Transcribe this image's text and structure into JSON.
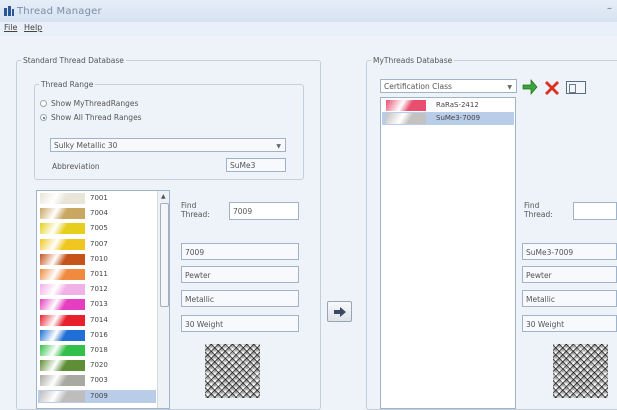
{
  "window": {
    "title": "Thread Manager",
    "minimize_glyph": "–"
  },
  "menu": {
    "items": [
      "File",
      "Help"
    ]
  },
  "standard_db": {
    "legend": "Standard Thread Database",
    "thread_range": {
      "legend": "Thread Range",
      "options": [
        "Show MyThreadRanges",
        "Show All Thread Ranges"
      ],
      "selected_index": 1
    },
    "range_select": {
      "value": "Sulky Metallic 30"
    },
    "abbreviation": {
      "label": "Abbreviation",
      "value": "SuMe3"
    },
    "threads": [
      {
        "code": "7001",
        "color": "#e9e5d9"
      },
      {
        "code": "7004",
        "color": "#c9a760"
      },
      {
        "code": "7005",
        "color": "#e6cf1c"
      },
      {
        "code": "7007",
        "color": "#f0c720"
      },
      {
        "code": "7010",
        "color": "#c6541a"
      },
      {
        "code": "7011",
        "color": "#f08a3e"
      },
      {
        "code": "7012",
        "color": "#f0b1e6"
      },
      {
        "code": "7013",
        "color": "#e63ec1"
      },
      {
        "code": "7014",
        "color": "#e8202e"
      },
      {
        "code": "7016",
        "color": "#1f6fd6"
      },
      {
        "code": "7018",
        "color": "#33c04a"
      },
      {
        "code": "7020",
        "color": "#5e8e35"
      },
      {
        "code": "7003",
        "color": "#a9a9a4"
      },
      {
        "code": "7009",
        "color": "#bfbdbc"
      }
    ],
    "selected_code": "7009",
    "find_label": "Find\nThread:",
    "find_value": "7009",
    "details": [
      "7009",
      "Pewter",
      "Metallic",
      "30 Weight"
    ]
  },
  "transfer_button": {
    "icon": "arrow-right-icon"
  },
  "my_db": {
    "legend": "MyThreads Database",
    "class_select": {
      "value": "Certification Class"
    },
    "toolbar_icons": [
      "add-green-arrow-icon",
      "delete-x-icon",
      "properties-icon"
    ],
    "items": [
      {
        "label": "RaRaS-2412",
        "color": "#e84f6f"
      },
      {
        "label": "SuMe3-7009",
        "color": "#c4c2c0"
      }
    ],
    "selected_index": 1,
    "find_label": "Find\nThread:",
    "find_value": "",
    "details": [
      "SuMe3-7009",
      "Pewter",
      "Metallic",
      "30 Weight"
    ]
  }
}
